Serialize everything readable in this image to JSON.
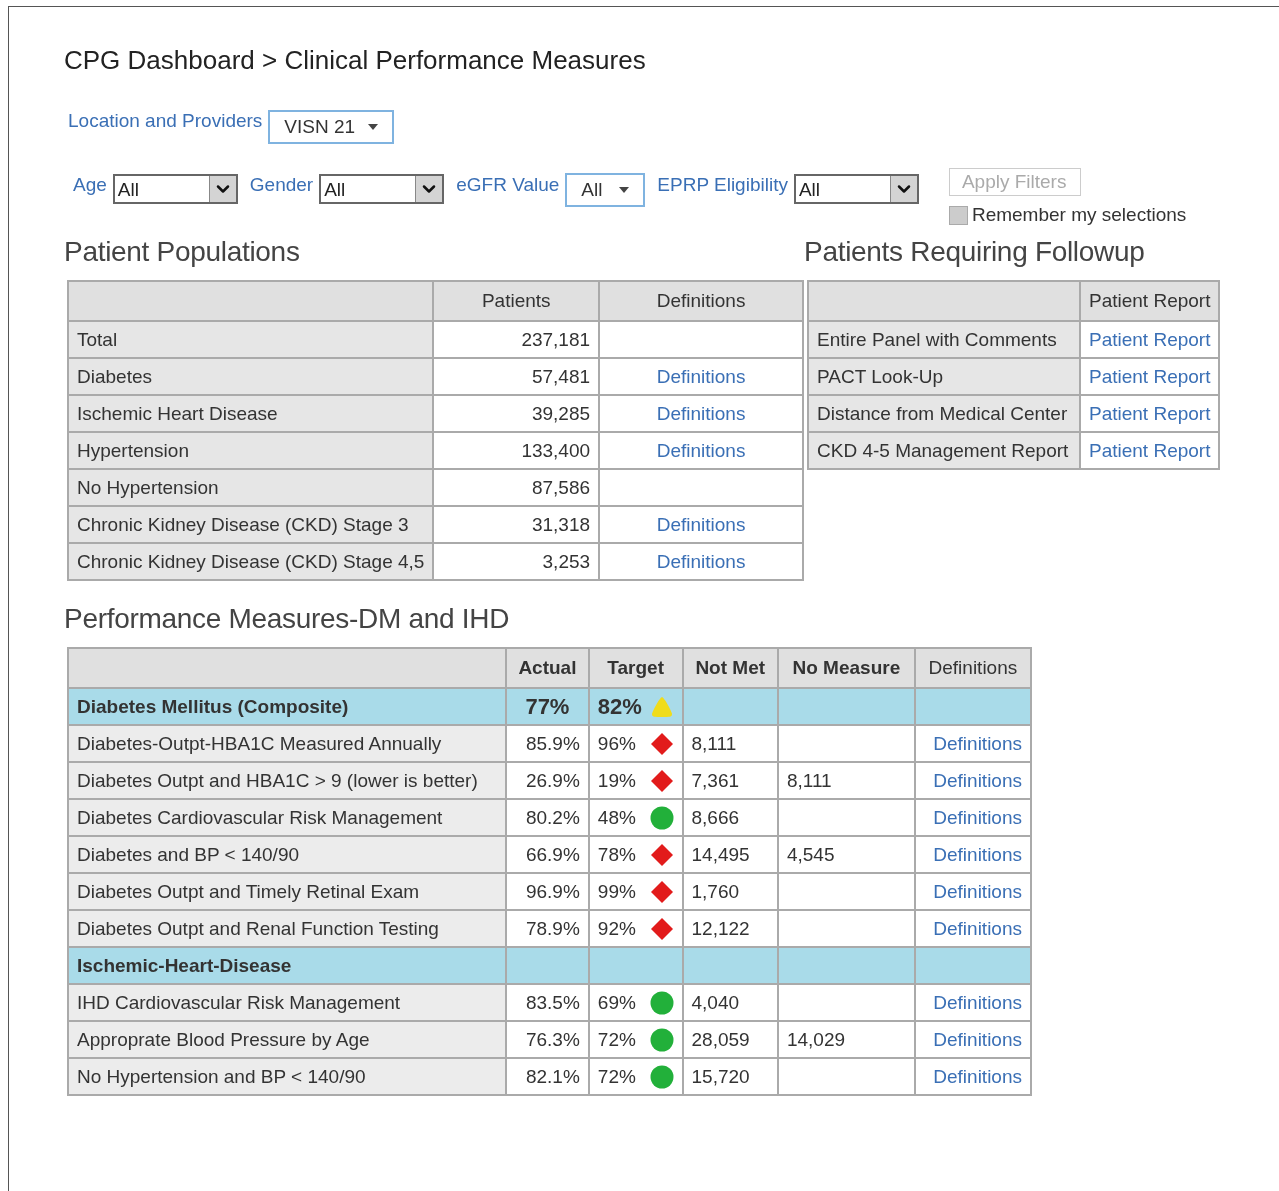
{
  "title": "CPG Dashboard > Clinical Performance Measures",
  "location": {
    "label": "Location and Providers",
    "value": "VISN 21"
  },
  "filters": [
    {
      "kind": "select",
      "label": "Age",
      "value": "All"
    },
    {
      "kind": "select",
      "label": "Gender",
      "value": "All"
    },
    {
      "kind": "dropdown",
      "label": "eGFR Value",
      "value": "All"
    },
    {
      "kind": "select",
      "label": "EPRP Eligibility",
      "value": "All"
    }
  ],
  "apply_button": {
    "label": "Apply Filters",
    "disabled": true
  },
  "remember": {
    "label": "Remember my selections",
    "checked": false
  },
  "populations": {
    "title": "Patient Populations",
    "columns": [
      "Patients",
      "Definitions"
    ],
    "rows": [
      {
        "name": "Total",
        "patients": "237,181"
      },
      {
        "name": "Diabetes",
        "patients": "57,481",
        "link": "Definitions"
      },
      {
        "name": "Ischemic Heart Disease",
        "patients": "39,285",
        "link": "Definitions"
      },
      {
        "name": "Hypertension",
        "patients": "133,400",
        "link": "Definitions"
      },
      {
        "name": "No Hypertension",
        "patients": "87,586"
      },
      {
        "name": "Chronic Kidney Disease (CKD) Stage 3",
        "patients": "31,318",
        "link": "Definitions"
      },
      {
        "name": "Chronic Kidney Disease (CKD) Stage 4,5",
        "patients": "3,253",
        "link": "Definitions"
      }
    ]
  },
  "followup": {
    "title": "Patients Requiring Followup",
    "columns": [
      "Patient Report"
    ],
    "rows": [
      {
        "name": "Entire Panel with Comments",
        "link": "Patient Report"
      },
      {
        "name": "PACT Look-Up",
        "link": "Patient Report"
      },
      {
        "name": "Distance from Medical Center",
        "link": "Patient Report"
      },
      {
        "name": "CKD 4-5 Management Report",
        "link": "Patient Report"
      }
    ]
  },
  "measures": {
    "title": "Performance Measures-DM and IHD",
    "columns": [
      "Actual",
      "Target",
      "Not Met",
      "No Measure",
      "Definitions"
    ],
    "rows": [
      {
        "kind": "group",
        "name": "Diabetes Mellitus (Composite)",
        "actual": "77%",
        "target": "82%",
        "indicator": {
          "kind": "triangle",
          "color": "#f0dc1a"
        }
      },
      {
        "kind": "measure",
        "name": "Diabetes-Outpt-HBA1C Measured Annually",
        "actual": "85.9%",
        "target": "96%",
        "indicator": {
          "kind": "diamond",
          "color": "#e21b1b"
        },
        "not_met": "8,111",
        "link": "Definitions"
      },
      {
        "kind": "measure",
        "name": "Diabetes Outpt and HBA1C > 9 (lower is better)",
        "actual": "26.9%",
        "target": "19%",
        "indicator": {
          "kind": "diamond",
          "color": "#e21b1b"
        },
        "not_met": "7,361",
        "no_measure": "8,111",
        "link": "Definitions"
      },
      {
        "kind": "measure",
        "name": "Diabetes Cardiovascular Risk Management",
        "actual": "80.2%",
        "target": "48%",
        "indicator": {
          "kind": "circle",
          "color": "#22b03a"
        },
        "not_met": "8,666",
        "link": "Definitions"
      },
      {
        "kind": "measure",
        "name": "Diabetes and BP < 140/90",
        "actual": "66.9%",
        "target": "78%",
        "indicator": {
          "kind": "diamond",
          "color": "#e21b1b"
        },
        "not_met": "14,495",
        "no_measure": "4,545",
        "link": "Definitions"
      },
      {
        "kind": "measure",
        "name": "Diabetes Outpt and Timely Retinal Exam",
        "actual": "96.9%",
        "target": "99%",
        "indicator": {
          "kind": "diamond",
          "color": "#e21b1b"
        },
        "not_met": "1,760",
        "link": "Definitions"
      },
      {
        "kind": "measure",
        "name": "Diabetes Outpt and Renal Function Testing",
        "actual": "78.9%",
        "target": "92%",
        "indicator": {
          "kind": "diamond",
          "color": "#e21b1b"
        },
        "not_met": "12,122",
        "link": "Definitions"
      },
      {
        "kind": "group",
        "name": "Ischemic-Heart-Disease"
      },
      {
        "kind": "measure",
        "name": "IHD Cardiovascular Risk Management",
        "actual": "83.5%",
        "target": "69%",
        "indicator": {
          "kind": "circle",
          "color": "#22b03a"
        },
        "not_met": "4,040",
        "link": "Definitions"
      },
      {
        "kind": "measure",
        "name": "Approprate Blood Pressure by Age",
        "actual": "76.3%",
        "target": "72%",
        "indicator": {
          "kind": "circle",
          "color": "#22b03a"
        },
        "not_met": "28,059",
        "no_measure": "14,029",
        "link": "Definitions"
      },
      {
        "kind": "measure",
        "name": "No Hypertension and BP < 140/90",
        "actual": "82.1%",
        "target": "72%",
        "indicator": {
          "kind": "circle",
          "color": "#22b03a"
        },
        "not_met": "15,720",
        "link": "Definitions"
      }
    ]
  }
}
